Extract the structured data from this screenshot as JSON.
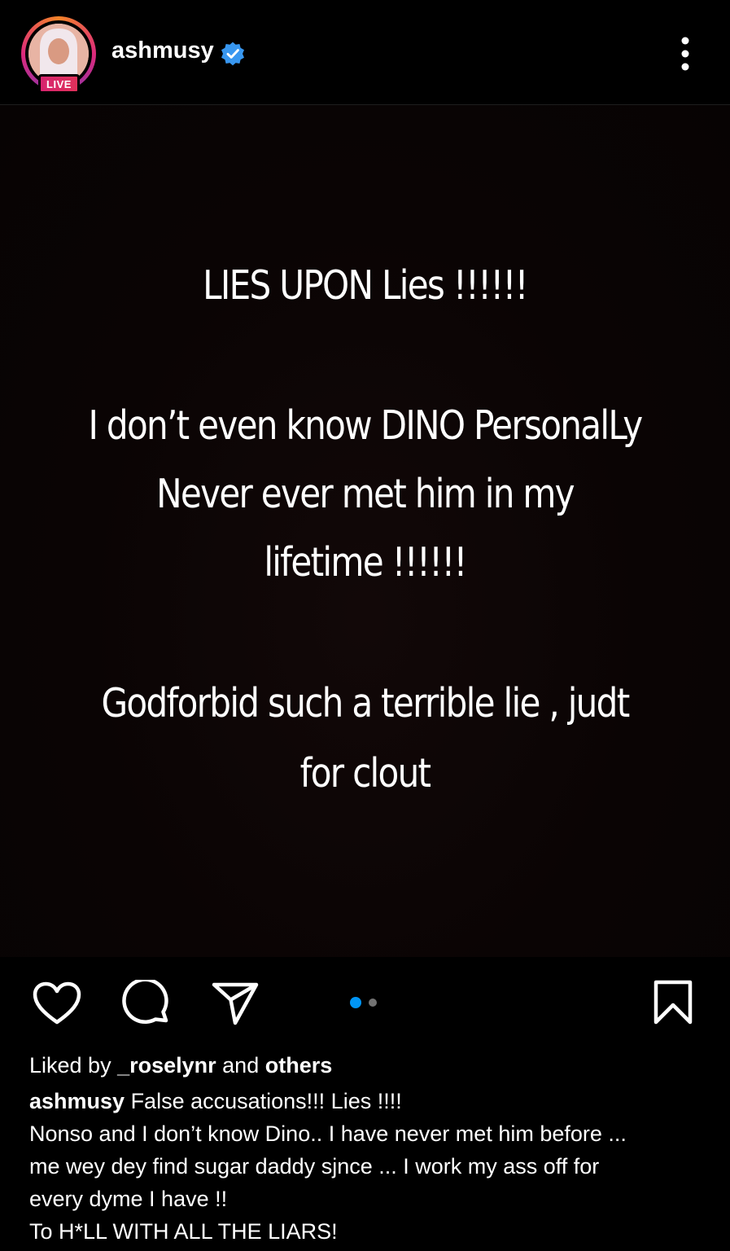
{
  "post": {
    "username": "ashmusy",
    "live_label": "LIVE",
    "verified": true,
    "text_lines": [
      "LIES UPON Lies !!!!!!",
      "I don’t even know DINO PersonalLy",
      "Never ever met him in my",
      "lifetime !!!!!!",
      "Godforbid such a terrible lie , judt",
      "for clout"
    ],
    "carousel": {
      "total": 2,
      "active": 1
    }
  },
  "icons": {
    "like": "heart-icon",
    "comment": "comment-icon",
    "share": "share-icon",
    "save": "bookmark-icon",
    "more": "more-options-icon",
    "verified": "verified-badge-icon"
  },
  "likes": {
    "prefix": "Liked by ",
    "user": "_roselynr",
    "and": " and ",
    "others": "others"
  },
  "caption": {
    "user": "ashmusy",
    "first_line": " False accusations!!! Lies !!!!",
    "lines": [
      "Nonso and I don’t know Dino.. I have never met him before ...",
      "me wey dey find sugar daddy sjnce ... I work my ass off for",
      "every dyme I have !!",
      "To H*LL WITH ALL THE LIARS!"
    ]
  },
  "colors": {
    "background": "#000000",
    "verified_blue": "#3897f0",
    "live_pink": "#d6246e",
    "dot_active": "#0095f6",
    "dot_inactive": "#737373"
  }
}
